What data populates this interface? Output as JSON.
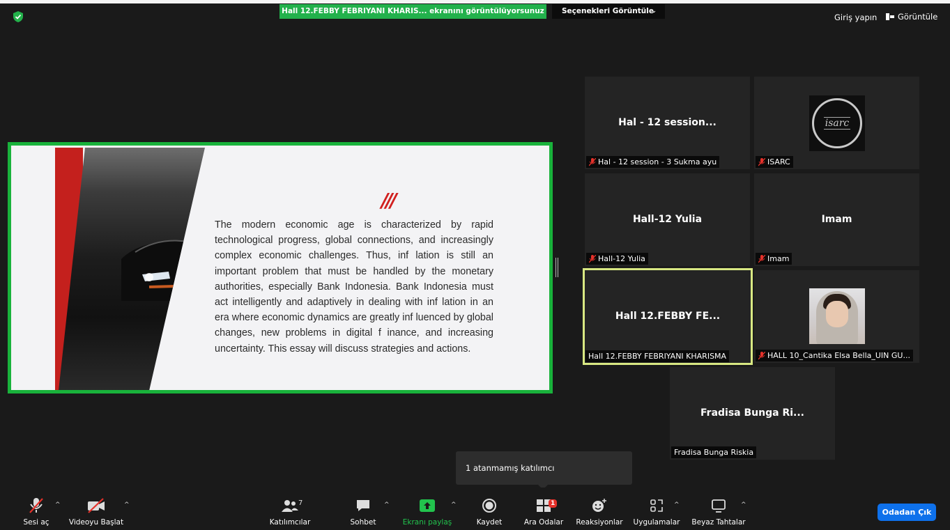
{
  "topbar": {
    "share_banner": "Hall 12.FEBBY FEBRIYANI  KHARIS... ekranını görüntülüyorsunuz",
    "options_label": "Seçenekleri Görüntüle",
    "signin_label": "Giriş yapın",
    "view_label": "Görüntüle"
  },
  "slide": {
    "paragraph": " The modern economic age is characterized by rapid technological progress, global connections, and increasingly complex economic challenges. Thus, inf lation is still an important problem that must be handled by the monetary authorities, especially Bank Indonesia. Bank Indonesia must act intelligently and adaptively in dealing with inf lation in an era where economic dynamics are greatly inf luenced by global changes, new problems in digital f inance, and increasing uncertainty. This essay will discuss strategies and actions.",
    "accent_color": "#c4201d"
  },
  "tiles": [
    {
      "title": "Hal - 12 session...",
      "nameplate": "Hal - 12 session - 3 Sukma ayu",
      "muted": true
    },
    {
      "title": "",
      "nameplate": "ISARC",
      "muted": true,
      "logo_text": "isarc"
    },
    {
      "title": "Hall-12 Yulia",
      "nameplate": "Hall-12 Yulia",
      "muted": true
    },
    {
      "title": "Imam",
      "nameplate": "Imam",
      "muted": true
    },
    {
      "title": "Hall 12.FEBBY FE...",
      "nameplate": "Hall 12.FEBBY FEBRIYANI KHARISMA",
      "muted": false,
      "active": true
    },
    {
      "title": "",
      "nameplate": "HALL 10_Cantika Elsa Bella_UIN GU...",
      "muted": true
    },
    {
      "title": "Fradisa Bunga Ri...",
      "nameplate": "Fradisa Bunga Riskia",
      "muted": false
    }
  ],
  "tooltip": "1 atanmamış katılımcı",
  "toolbar": {
    "mute_label": "Sesi aç",
    "video_label": "Videoyu Başlat",
    "participants_label": "Katılımcılar",
    "participants_count": "7",
    "chat_label": "Sohbet",
    "share_label": "Ekranı paylaş",
    "record_label": "Kaydet",
    "breakout_label": "Ara Odalar",
    "breakout_badge": "1",
    "reactions_label": "Reaksiyonlar",
    "apps_label": "Uygulamalar",
    "whiteboard_label": "Beyaz Tahtalar",
    "leave_label": "Odadan Çık"
  },
  "colors": {
    "share_green": "#22b14c",
    "active_border": "#d8e882",
    "leave_blue": "#0e71eb",
    "mute_red": "#e5312a"
  }
}
